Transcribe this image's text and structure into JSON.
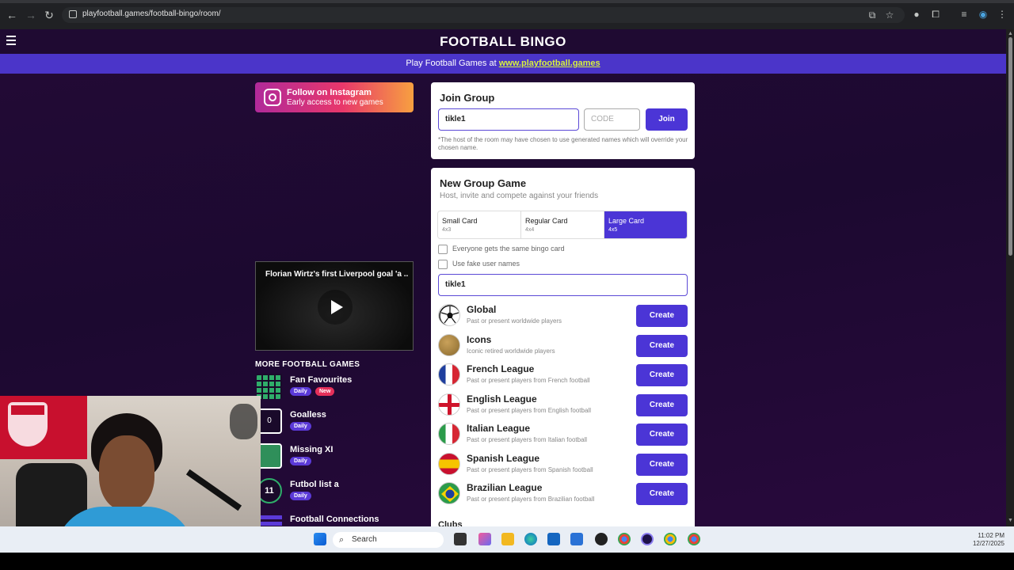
{
  "browser": {
    "url": "playfootball.games/football-bingo/room/"
  },
  "header": {
    "title": "FOOTBALL BINGO",
    "banner_text": "Play Football Games at ",
    "banner_link": "www.playfootball.games"
  },
  "instagram": {
    "title": "Follow on Instagram",
    "subtitle": "Early access to new games"
  },
  "video": {
    "title": "Florian Wirtz's first Liverpool goal 'a ..."
  },
  "more_games": {
    "title": "MORE FOOTBALL GAMES",
    "items": [
      {
        "name": "Fan Favourites",
        "badges": [
          "Daily",
          "New"
        ]
      },
      {
        "name": "Goalless",
        "badges": [
          "Daily"
        ]
      },
      {
        "name": "Missing XI",
        "badges": [
          "Daily"
        ]
      },
      {
        "name": "Futbol list a",
        "badges": [
          "Daily"
        ]
      },
      {
        "name": "Football Connections",
        "badges": []
      }
    ]
  },
  "join_group": {
    "title": "Join Group",
    "name_value": "tikle1",
    "code_placeholder": "CODE",
    "join_label": "Join",
    "note": "*The host of the room may have chosen to use generated names which will override your chosen name."
  },
  "new_group": {
    "title": "New Group Game",
    "subtitle": "Host, invite and compete against your friends",
    "card_sizes": [
      {
        "label": "Small Card",
        "sub": "4x3",
        "active": false
      },
      {
        "label": "Regular Card",
        "sub": "4x4",
        "active": false
      },
      {
        "label": "Large Card",
        "sub": "4x5",
        "active": true
      }
    ],
    "checkbox_same_card": "Everyone gets the same bingo card",
    "checkbox_fake_names": "Use fake user names",
    "name_value": "tikle1",
    "create_label": "Create",
    "leagues": [
      {
        "name": "Global",
        "desc": "Past or present worldwide players"
      },
      {
        "name": "Icons",
        "desc": "Iconic retired worldwide players"
      },
      {
        "name": "French League",
        "desc": "Past or present players from French football"
      },
      {
        "name": "English League",
        "desc": "Past or present players from English football"
      },
      {
        "name": "Italian League",
        "desc": "Past or present players from Italian football"
      },
      {
        "name": "Spanish League",
        "desc": "Past or present players from Spanish football"
      },
      {
        "name": "Brazilian League",
        "desc": "Past or present players from Brazilian football"
      }
    ],
    "next_section": "Clubs"
  },
  "taskbar": {
    "search_label": "Search",
    "time": "11:02 PM",
    "date": "12/27/2025"
  },
  "colors": {
    "accent": "#4b35d6",
    "banner": "#4b35c9",
    "banner_link": "#d8f23c",
    "page_bg": "#230a36"
  }
}
